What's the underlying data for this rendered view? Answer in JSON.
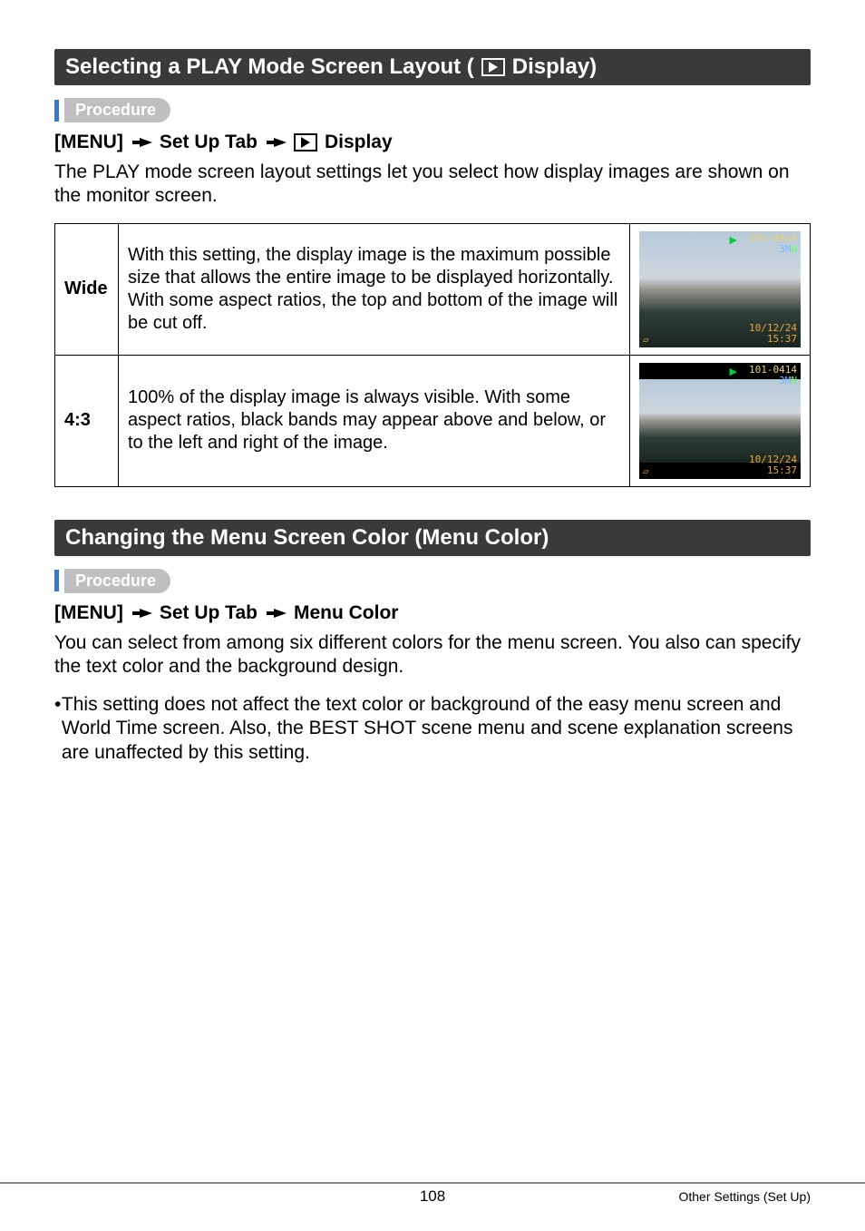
{
  "section1": {
    "title_before_icon": "Selecting a PLAY Mode Screen Layout (",
    "title_after_icon": " Display)",
    "procedure_label": "Procedure",
    "bold_menu": "[MENU]",
    "bold_setup": "Set Up Tab",
    "bold_display": "Display",
    "para": "The PLAY mode screen layout settings let you select how display images are shown on the monitor screen."
  },
  "table": {
    "rows": [
      {
        "label": "Wide",
        "desc": "With this setting, the display image is the maximum possible size that allows the entire image to be displayed horizontally. With some aspect ratios, the top and bottom of the image will be cut off.",
        "letterbox": false,
        "osd": {
          "tr1": "101-0414",
          "tr2": "3M",
          "br1": "10/12/24",
          "br2": "15:37"
        }
      },
      {
        "label": "4:3",
        "desc": "100% of the display image is always visible. With some aspect ratios, black bands may appear above and below, or to the left and right of the image.",
        "letterbox": true,
        "osd": {
          "tr1": "101-0414",
          "tr2": "3M",
          "br1": "10/12/24",
          "br2": "15:37"
        }
      }
    ]
  },
  "section2": {
    "title": "Changing the Menu Screen Color (Menu Color)",
    "procedure_label": "Procedure",
    "bold_menu": "[MENU]",
    "bold_setup": "Set Up Tab",
    "bold_menucolor": "Menu Color",
    "para": "You can select from among six different colors for the menu screen. You also can specify the text color and the background design.",
    "bullet": "This setting does not affect the text color or background of the easy menu screen and World Time screen. Also, the BEST SHOT scene menu and scene explanation screens are unaffected by this setting."
  },
  "footer": {
    "page": "108",
    "right": "Other Settings (Set Up)"
  }
}
